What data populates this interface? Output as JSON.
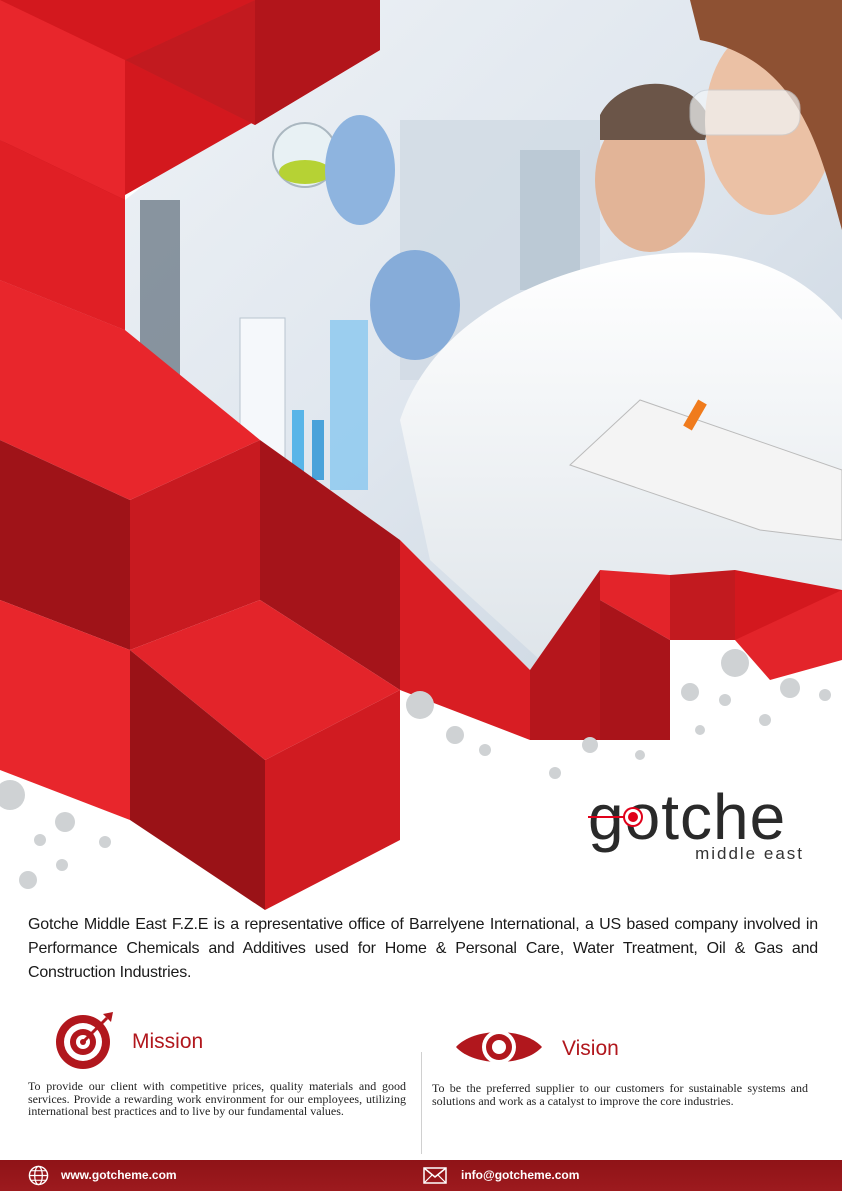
{
  "brand": {
    "name": "gotche",
    "tagline": "middle east",
    "accent_color": "#e0001a",
    "primary_red": "#c9191e",
    "dark_red": "#9a1418"
  },
  "intro": {
    "text": "Gotche Middle East F.Z.E is a representative office of Barrelyene International, a US based company involved in Performance Chemicals and Additives used for Home & Personal Care, Water Treatment, Oil & Gas and Construction Industries."
  },
  "mission": {
    "icon": "target-icon",
    "heading": "Mission",
    "text": "To provide our client with competitive prices, quality materials and good services. Provide a rewarding work environment for our employees, utilizing international best practices and to live by our fundamental values."
  },
  "vision": {
    "icon": "eye-icon",
    "heading": "Vision",
    "text": "To be the preferred supplier to our customers for sustainable systems and solutions and work as a catalyst to improve the core industries."
  },
  "footer": {
    "website_icon": "globe-icon",
    "website": "www.gotcheme.com",
    "email_icon": "envelope-icon",
    "email": "info@gotcheme.com"
  }
}
